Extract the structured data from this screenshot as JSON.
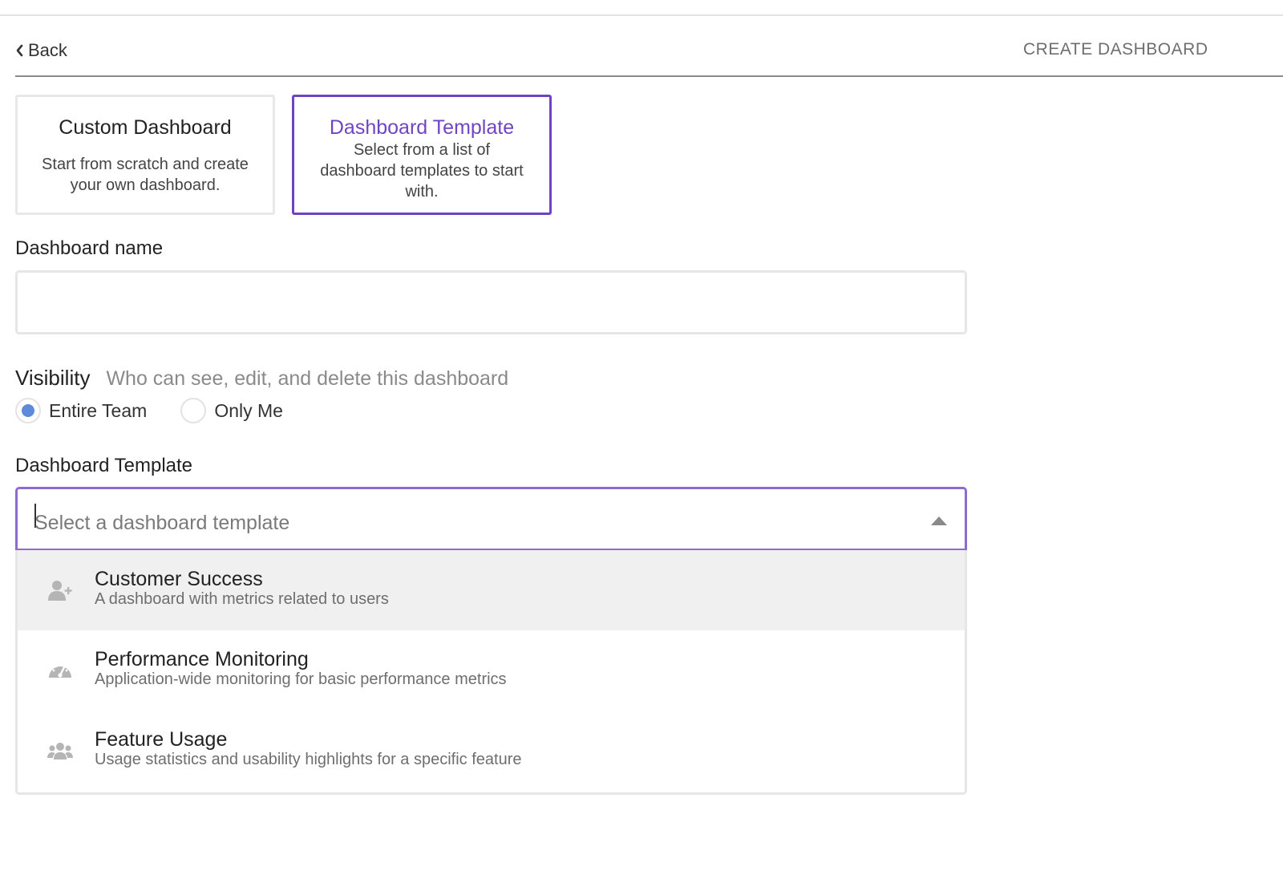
{
  "header": {
    "back_label": "Back",
    "title": "CREATE DASHBOARD"
  },
  "cards": {
    "custom": {
      "title": "Custom Dashboard",
      "description": "Start from scratch and create your own dashboard."
    },
    "template": {
      "title": "Dashboard Template",
      "description": "Select from a list of dashboard templates to start with.",
      "selected": true
    }
  },
  "form": {
    "name_label": "Dashboard name",
    "name_value": "",
    "visibility_label": "Visibility",
    "visibility_hint": "Who can see, edit, and delete this dashboard",
    "visibility_options": [
      {
        "label": "Entire Team",
        "checked": true
      },
      {
        "label": "Only Me",
        "checked": false
      }
    ],
    "template_label": "Dashboard Template",
    "template_placeholder": "Select a dashboard template"
  },
  "dropdown": {
    "options": [
      {
        "title": "Customer Success",
        "description": "A dashboard with metrics related to users",
        "icon": "user-plus-icon",
        "highlighted": true
      },
      {
        "title": "Performance Monitoring",
        "description": "Application-wide monitoring for basic performance metrics",
        "icon": "speedometer-icon",
        "highlighted": false
      },
      {
        "title": "Feature Usage",
        "description": "Usage statistics and usability highlights for a specific feature",
        "icon": "users-group-icon",
        "highlighted": false
      }
    ]
  },
  "colors": {
    "accent": "#6f42c1",
    "radio_selected": "#5b8bd9",
    "highlight_row": "#f0f0f0"
  }
}
